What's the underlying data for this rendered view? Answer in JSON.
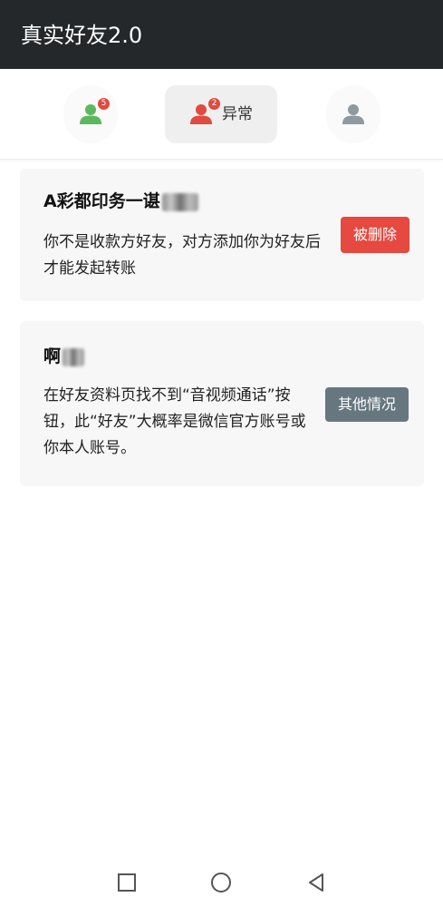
{
  "app": {
    "title": "真实好友2.0"
  },
  "tabs": [
    {
      "id": "normal",
      "label": "",
      "icon": "user-icon",
      "badge": "5",
      "color": "#5cb85c"
    },
    {
      "id": "abnormal",
      "label": "异常",
      "icon": "user-icon",
      "badge": "2",
      "color": "#e04a3f",
      "selected": true
    },
    {
      "id": "profile",
      "label": "",
      "icon": "user-icon",
      "color": "#8e9aa0"
    }
  ],
  "friends": [
    {
      "name": "A彩都印务一谌",
      "message": "你不是收款方好友，对方添加你为好友后才能发起转账",
      "status": "被删除",
      "status_color": "#e5493f"
    },
    {
      "name": "啊",
      "message": "在好友资料页找不到“音视频通话”按钮，此“好友”大概率是微信官方账号或你本人账号。",
      "status": "其他情况",
      "status_color": "#66777f"
    }
  ],
  "navbar": {
    "recent": "square-icon",
    "home": "circle-icon",
    "back": "triangle-back-icon"
  }
}
